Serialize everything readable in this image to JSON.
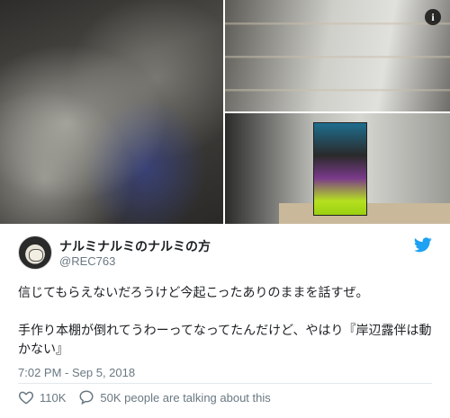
{
  "media": {
    "badge": "i",
    "photos": [
      {
        "name": "collapsed-bookshelf-photo"
      },
      {
        "name": "shelf-planks-photo"
      },
      {
        "name": "standing-manga-photo"
      }
    ]
  },
  "user": {
    "name": "ナルミナルミのナルミの方",
    "handle": "@REC763"
  },
  "tweet": {
    "line1": "信じてもらえないだろうけど今起こったありのままを話すぜ。",
    "line2": "手作り本棚が倒れてうわーってなってたんだけど、やはり『岸辺露伴は動かない』"
  },
  "meta": {
    "timestamp": "7:02 PM - Sep 5, 2018"
  },
  "actions": {
    "likes": "110K",
    "talking": "50K people are talking about this"
  },
  "colors": {
    "text": "#1c2022",
    "secondary": "#697882",
    "twitter_blue": "#1da1f2",
    "border": "#e1e8ed"
  }
}
